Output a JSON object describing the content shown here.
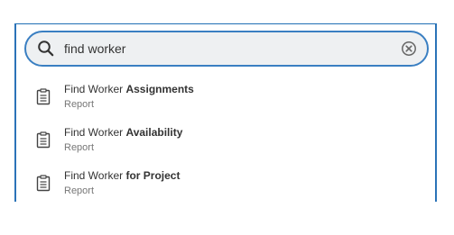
{
  "search": {
    "value": "find worker",
    "icon": "search-icon",
    "clear_icon": "clear-circle-icon"
  },
  "results": [
    {
      "title_plain": "Find Worker ",
      "title_bold": "Assignments",
      "type": "Report",
      "icon": "report-clipboard-icon"
    },
    {
      "title_plain": "Find Worker ",
      "title_bold": "Availability",
      "type": "Report",
      "icon": "report-clipboard-icon"
    },
    {
      "title_plain": "Find Worker ",
      "title_bold": "for Project",
      "type": "Report",
      "icon": "report-clipboard-icon"
    }
  ],
  "colors": {
    "accent": "#2b73b8",
    "search_bg": "#eef0f2",
    "text": "#333333",
    "subtext": "#777777"
  }
}
